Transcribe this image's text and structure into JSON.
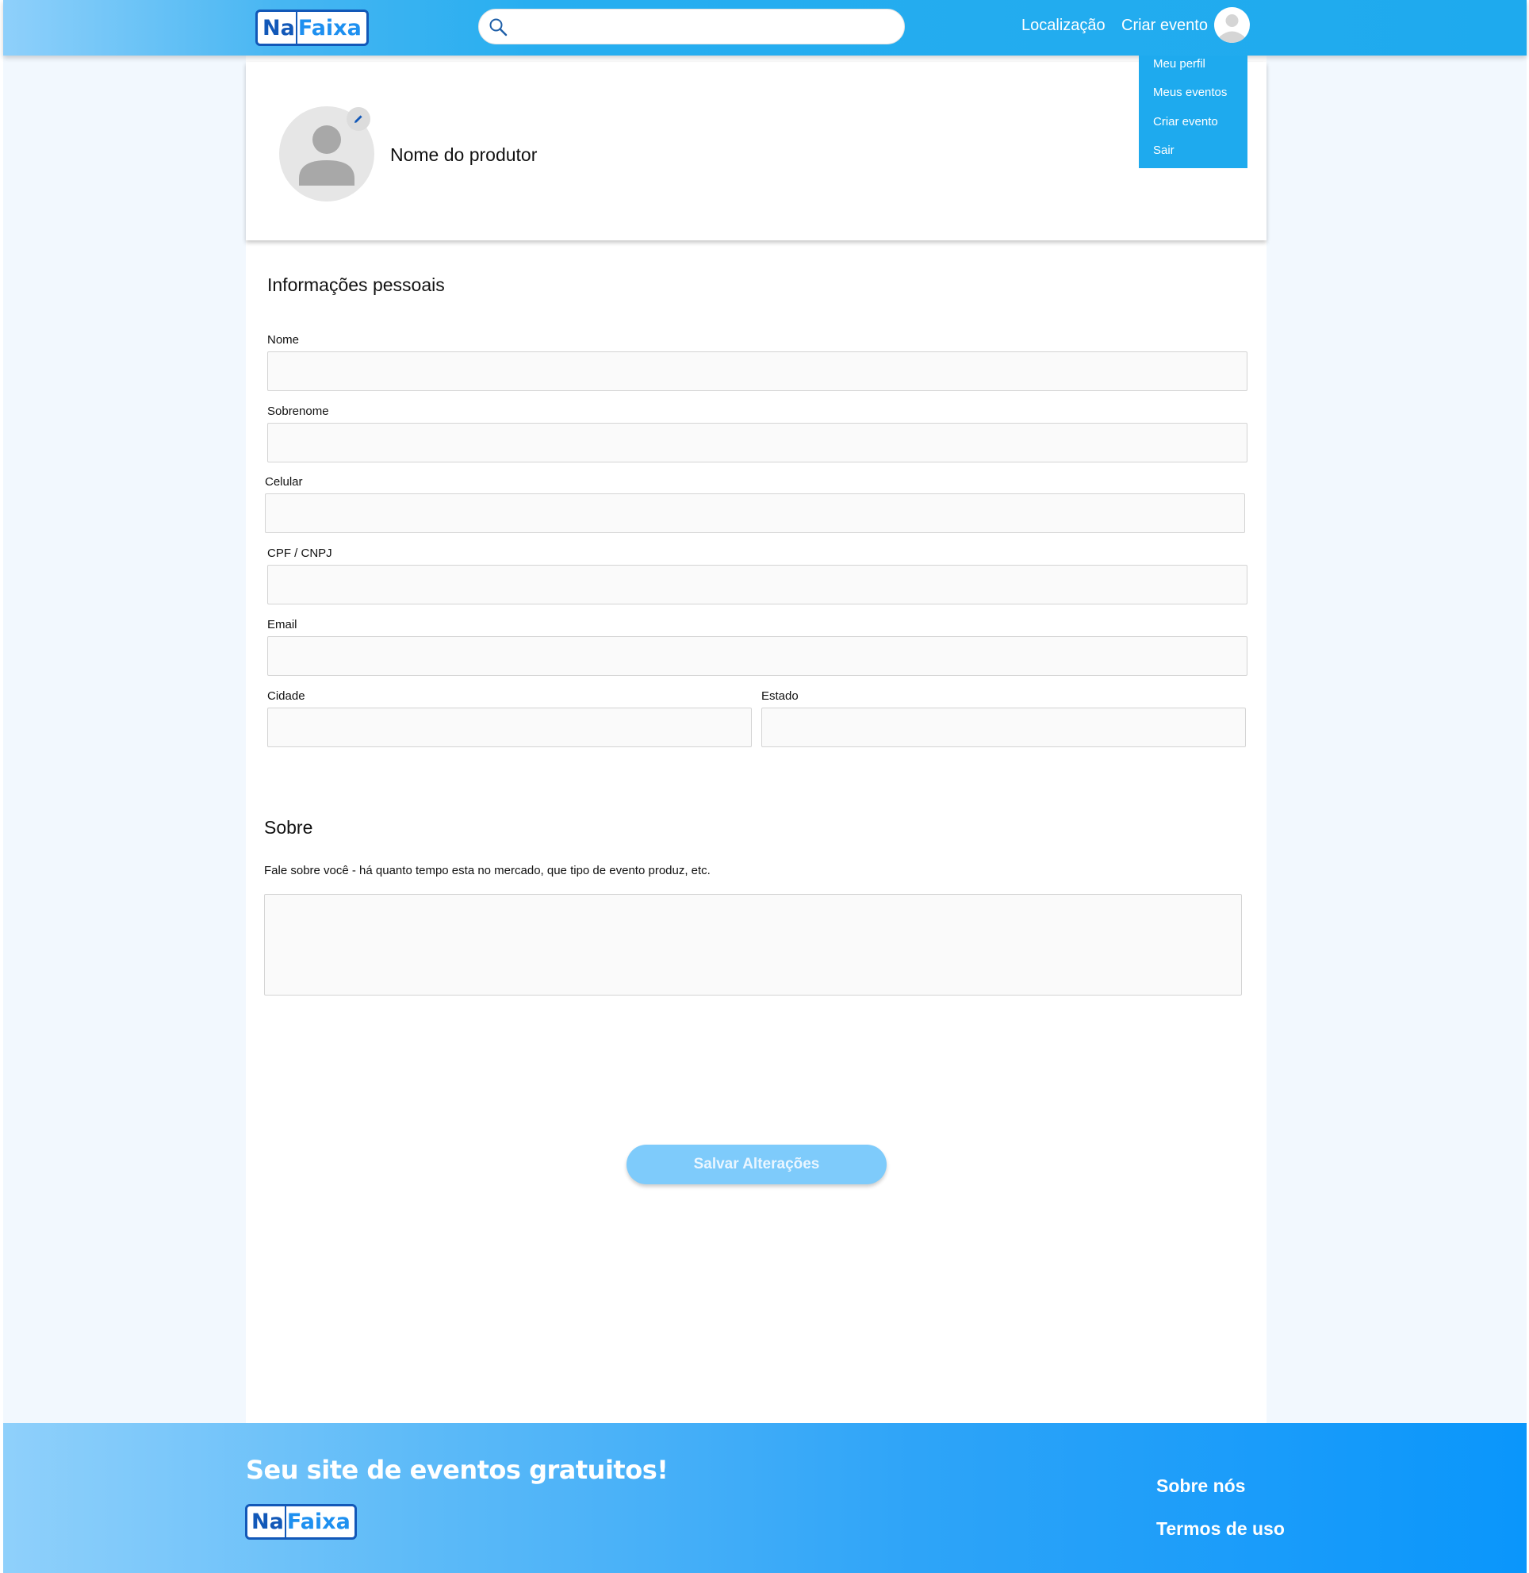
{
  "header": {
    "logo_na": "Na",
    "logo_faixa": "Faixa",
    "search_placeholder": "",
    "nav_location": "Localização",
    "nav_create_event": "Criar evento"
  },
  "user_menu": {
    "items": [
      "Meu perfil",
      "Meus eventos",
      "Criar evento",
      "Sair"
    ]
  },
  "profile": {
    "producer_name": "Nome do produtor"
  },
  "personal_info": {
    "title": "Informações pessoais",
    "fields": {
      "nome": {
        "label": "Nome",
        "value": ""
      },
      "sobrenome": {
        "label": "Sobrenome",
        "value": ""
      },
      "celular": {
        "label": "Celular",
        "value": ""
      },
      "cpf_cnpj": {
        "label": "CPF / CNPJ",
        "value": ""
      },
      "email": {
        "label": "Email",
        "value": ""
      },
      "cidade": {
        "label": "Cidade",
        "value": ""
      },
      "estado": {
        "label": "Estado",
        "value": ""
      }
    }
  },
  "about": {
    "title": "Sobre",
    "hint": "Fale sobre você - há quanto tempo esta no mercado, que tipo de evento produz, etc.",
    "value": ""
  },
  "actions": {
    "save_label": "Salvar Alterações"
  },
  "footer": {
    "tagline": "Seu site de eventos gratuitos!",
    "logo_na": "Na",
    "logo_faixa": "Faixa",
    "about_link": "Sobre nós",
    "terms_link": "Termos de uso"
  },
  "colors": {
    "brand_blue": "#1eaaee",
    "logo_dark": "#1258b8",
    "button": "#7ecbfb"
  }
}
